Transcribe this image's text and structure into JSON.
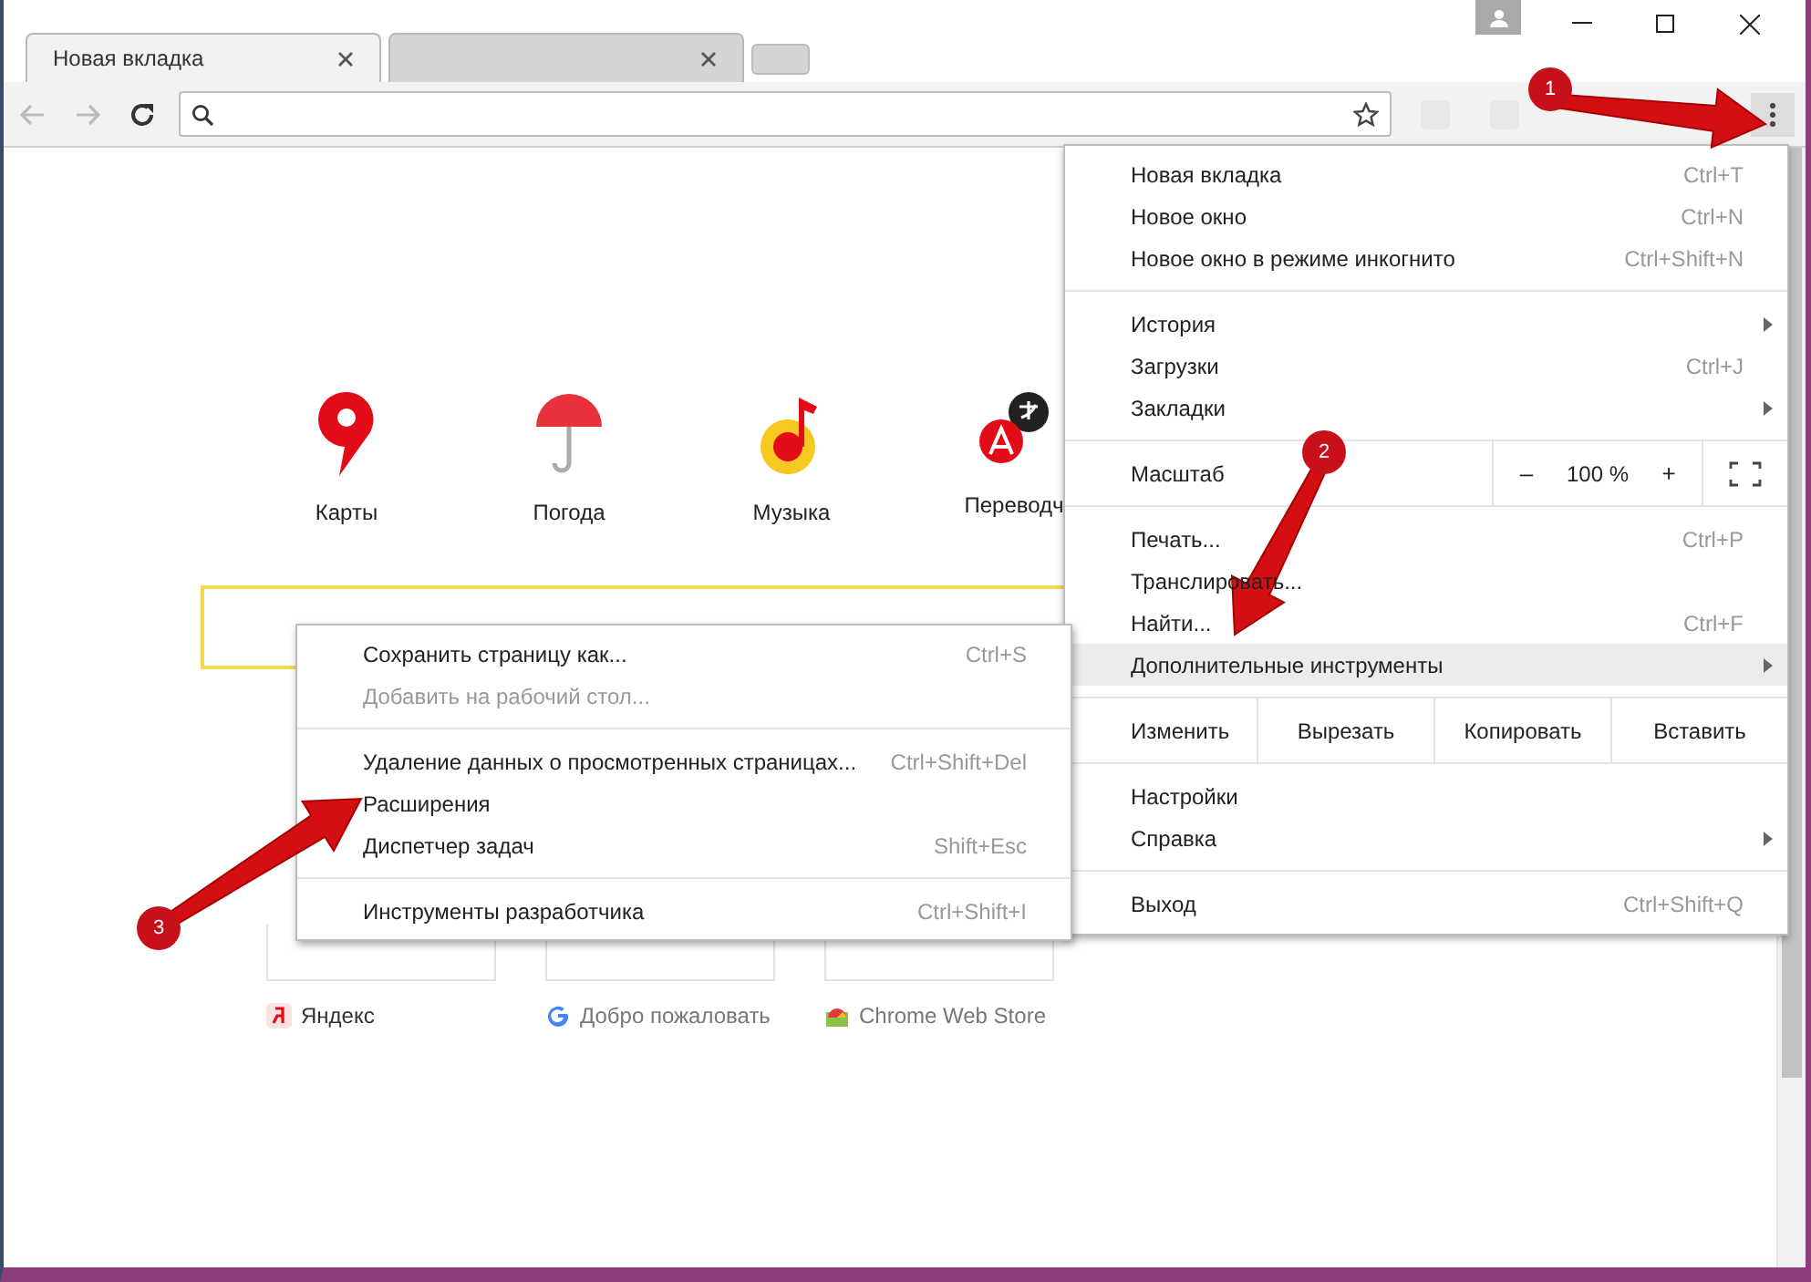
{
  "tabs": [
    {
      "label": "Новая вкладка",
      "selected": true
    },
    {
      "selected": false
    }
  ],
  "tiles": [
    {
      "kind": "maps",
      "label": "Карты"
    },
    {
      "kind": "weather",
      "label": "Погода"
    },
    {
      "kind": "music",
      "label": "Музыка"
    },
    {
      "kind": "translate",
      "label": "Переводч"
    }
  ],
  "bookmarks": [
    {
      "kind": "yandex",
      "label": "Яндекс"
    },
    {
      "kind": "google",
      "label": "Добро пожаловать"
    },
    {
      "kind": "store",
      "label": "Chrome Web Store"
    }
  ],
  "menu": {
    "sections": [
      [
        {
          "kind": "item",
          "label": "Новая вкладка",
          "shortcut": "Ctrl+T",
          "submenu": false,
          "selected": false
        },
        {
          "kind": "item",
          "label": "Новое окно",
          "shortcut": "Ctrl+N",
          "submenu": false,
          "selected": false
        },
        {
          "kind": "item",
          "label": "Новое окно в режиме инкогнито",
          "shortcut": "Ctrl+Shift+N",
          "submenu": false,
          "selected": false
        }
      ],
      [
        {
          "kind": "item",
          "label": "История",
          "submenu": true,
          "selected": false
        },
        {
          "kind": "item",
          "label": "Загрузки",
          "shortcut": "Ctrl+J",
          "submenu": false,
          "selected": false
        },
        {
          "kind": "item",
          "label": "Закладки",
          "submenu": true,
          "selected": false
        }
      ],
      [
        {
          "kind": "zoom",
          "label": "Масштаб",
          "minus": "–",
          "value": "100 %",
          "plus": "+"
        }
      ],
      [
        {
          "kind": "item",
          "label": "Печать...",
          "shortcut": "Ctrl+P",
          "submenu": false,
          "selected": false
        },
        {
          "kind": "item",
          "label": "Транслировать...",
          "submenu": false,
          "selected": false
        },
        {
          "kind": "item",
          "label": "Найти...",
          "shortcut": "Ctrl+F",
          "submenu": false,
          "selected": false
        },
        {
          "kind": "item",
          "label": "Дополнительные инструменты",
          "submenu": true,
          "selected": true
        }
      ],
      [
        {
          "kind": "edit",
          "label": "Изменить",
          "buttons": [
            "Вырезать",
            "Копировать",
            "Вставить"
          ]
        }
      ],
      [
        {
          "kind": "item",
          "label": "Настройки",
          "submenu": false,
          "selected": false
        },
        {
          "kind": "item",
          "label": "Справка",
          "submenu": true,
          "selected": false
        }
      ],
      [
        {
          "kind": "item",
          "label": "Выход",
          "shortcut": "Ctrl+Shift+Q",
          "submenu": false,
          "selected": false
        }
      ]
    ]
  },
  "submenu": {
    "sections": [
      [
        {
          "label": "Сохранить страницу как...",
          "shortcut": "Ctrl+S",
          "disabled": false
        },
        {
          "label": "Добавить на рабочий стол...",
          "disabled": true
        }
      ],
      [
        {
          "label": "Удаление данных о просмотренных страницах...",
          "shortcut": "Ctrl+Shift+Del",
          "disabled": false
        },
        {
          "label": "Расширения",
          "disabled": false
        },
        {
          "label": "Диспетчер задач",
          "shortcut": "Shift+Esc",
          "disabled": false
        }
      ],
      [
        {
          "label": "Инструменты разработчика",
          "shortcut": "Ctrl+Shift+I",
          "disabled": false
        }
      ]
    ]
  },
  "annotations": [
    {
      "number": "1"
    },
    {
      "number": "2"
    },
    {
      "number": "3"
    }
  ]
}
